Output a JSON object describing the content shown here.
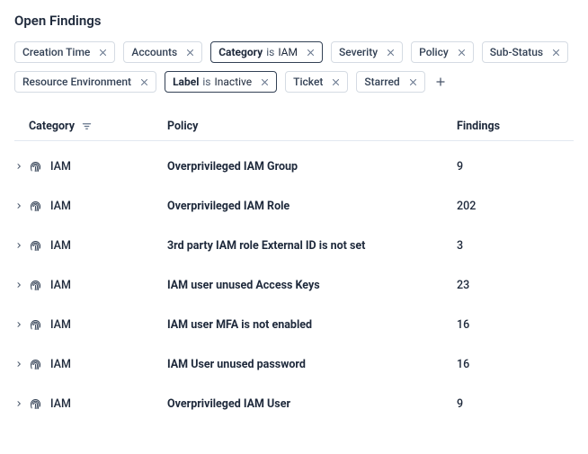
{
  "title": "Open Findings",
  "chips": [
    {
      "label": "Creation Time",
      "active": false
    },
    {
      "label": "Accounts",
      "active": false
    },
    {
      "label": "Category",
      "active": true,
      "sep": "is",
      "value": "IAM"
    },
    {
      "label": "Severity",
      "active": false
    },
    {
      "label": "Policy",
      "active": false
    },
    {
      "label": "Sub-Status",
      "active": false
    },
    {
      "label": "Resource Environment",
      "active": false
    },
    {
      "label": "Label",
      "active": true,
      "sep": "is",
      "value": "Inactive"
    },
    {
      "label": "Ticket",
      "active": false
    },
    {
      "label": "Starred",
      "active": false
    }
  ],
  "headers": {
    "category": "Category",
    "policy": "Policy",
    "findings": "Findings"
  },
  "rows": [
    {
      "category": "IAM",
      "policy": "Overprivileged IAM Group",
      "findings": "9"
    },
    {
      "category": "IAM",
      "policy": "Overprivileged IAM Role",
      "findings": "202"
    },
    {
      "category": "IAM",
      "policy": "3rd party IAM role External ID is not set",
      "findings": "3"
    },
    {
      "category": "IAM",
      "policy": "IAM user unused Access Keys",
      "findings": "23"
    },
    {
      "category": "IAM",
      "policy": "IAM user MFA is not enabled",
      "findings": "16"
    },
    {
      "category": "IAM",
      "policy": "IAM User unused password",
      "findings": "16"
    },
    {
      "category": "IAM",
      "policy": "Overprivileged IAM User",
      "findings": "9"
    }
  ]
}
